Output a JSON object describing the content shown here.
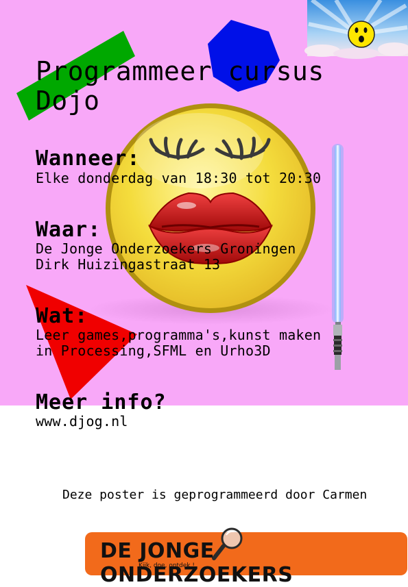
{
  "colors": {
    "background_pink": "#f8a8f8",
    "page_white": "#ffffff",
    "green_rect": "#00a800",
    "blue_heptagon": "#0010e8",
    "red_triangle": "#f00000",
    "face_yellow": "#f4dc3c",
    "lips_red": "#d81818",
    "saber_blade": "#9fe4ff",
    "logo_orange": "#f26a1b"
  },
  "poster": {
    "title_line1": "Programmeer cursus",
    "title_line2": "Dojo",
    "when_heading": "Wanneer:",
    "when_text": "Elke donderdag van 18:30 tot 20:30",
    "where_heading": "Waar:",
    "where_line1": "De Jonge Onderzoekers Groningen",
    "where_line2": "Dirk Huizingastraat 13",
    "what_heading": "Wat:",
    "what_line1": "Leer games,programma's,kunst maken",
    "what_line2": "in Processing,SFML en Urho3D",
    "info_heading": "Meer info?",
    "info_text": "www.djog.nl",
    "credit": "Deze poster is geprogrammeerd door Carmen"
  },
  "icons": {
    "face": "kissing-smiley-icon",
    "corner": "sky-smiley-icon",
    "saber": "lightsaber-icon",
    "magnifier": "magnifying-glass-icon"
  },
  "logo": {
    "name": "DE JONGE ONDERZOEKERS",
    "tagline": "Kijk, doe, ontdek !"
  }
}
